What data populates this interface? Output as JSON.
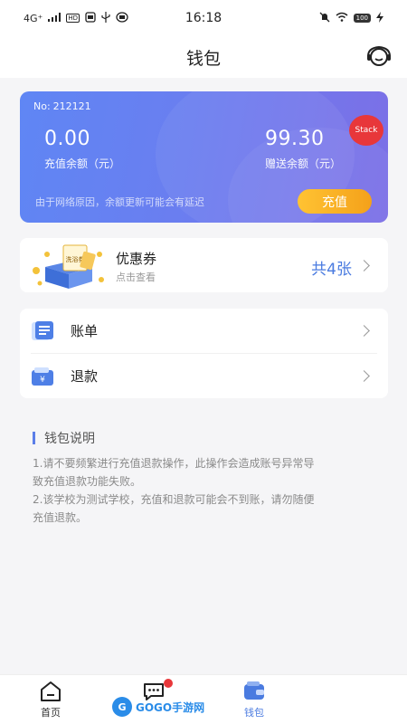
{
  "status_bar": {
    "network": "4G⁺",
    "chip_hd": "HD",
    "time": "16:18",
    "battery": "100"
  },
  "header": {
    "title": "钱包",
    "support_icon": "headset-icon"
  },
  "wallet": {
    "no_label": "No:",
    "no_value": "212121",
    "recharge_balance_value": "0.00",
    "recharge_balance_label": "充值余额（元）",
    "gift_balance_value": "99.30",
    "gift_balance_label": "赠送余额（元）",
    "stack_badge": "Stack",
    "network_note": "由于网络原因，余额更新可能会有延迟",
    "recharge_button": "充值",
    "colors": {
      "card_start": "#5f86f4",
      "card_end": "#7c6fe6",
      "button": "#f8b026"
    }
  },
  "coupon": {
    "title": "优惠券",
    "subtitle": "点击查看",
    "count": "共4张",
    "art_label": "洗浴券"
  },
  "menu": {
    "items": [
      {
        "label": "账单",
        "icon": "bill-icon"
      },
      {
        "label": "退款",
        "icon": "refund-wallet-icon"
      }
    ]
  },
  "notes": {
    "title": "钱包说明",
    "line1a": "1.请不要频繁进行充值退款操作，此操作会造成账号异常导",
    "line1b": "致充值退款功能失败。",
    "line2a": "2.该学校为测试学校，充值和退款可能会不到账，请勿随便",
    "line2b": "充值退款。"
  },
  "tabbar": {
    "tabs": [
      {
        "label": "首页",
        "icon": "home-icon"
      },
      {
        "label": "",
        "icon": "message-icon"
      },
      {
        "label": "钱包",
        "icon": "wallet-icon",
        "active": true
      }
    ],
    "accent": "#4a7be0",
    "watermark": "GOGO手游网"
  }
}
